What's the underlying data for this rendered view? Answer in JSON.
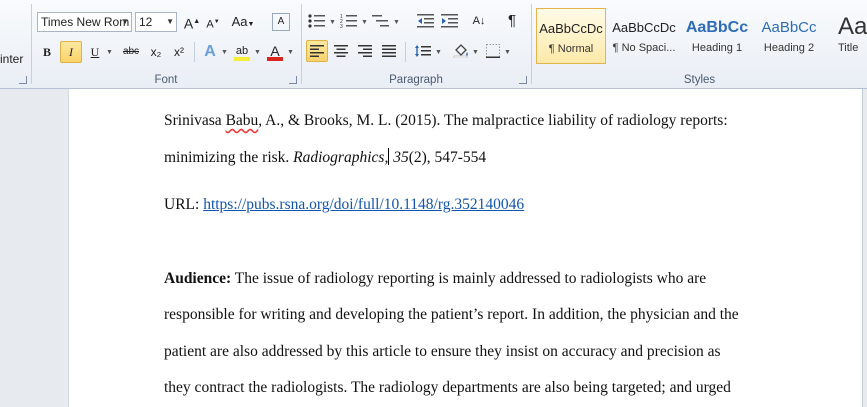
{
  "ribbon": {
    "clipboard": {
      "label": "inter"
    },
    "font": {
      "label": "Font",
      "font_name": "Times New Rom",
      "font_size": "12",
      "grow_glyph": "A",
      "shrink_glyph": "A",
      "change_case_glyph": "Aa",
      "clear_glyph": "A",
      "bold_glyph": "B",
      "italic_glyph": "I",
      "underline_glyph": "U",
      "strike_glyph": "abc",
      "subscript_glyph": "x₂",
      "superscript_glyph": "x²",
      "effects_glyph": "A",
      "highlight_glyph": "ab",
      "color_glyph": "A",
      "highlight_color": "#f6ee3a",
      "font_color": "#d7261e"
    },
    "paragraph": {
      "label": "Paragraph",
      "pilcrow_glyph": "¶",
      "sort_glyph": "A↓"
    },
    "styles": {
      "label": "Styles",
      "items": [
        {
          "preview": "AaBbCcDc",
          "name": "¶ Normal"
        },
        {
          "preview": "AaBbCcDc",
          "name": "¶ No Spaci..."
        },
        {
          "preview": "AaBbCc",
          "name": "Heading 1"
        },
        {
          "preview": "AaBbCc",
          "name": "Heading 2"
        },
        {
          "preview": "Aa",
          "name": "Title"
        }
      ],
      "heading_color": "#2e6db5"
    }
  },
  "document": {
    "ref_line1_pre": "Srinivasa ",
    "ref_line1_name": "Babu",
    "ref_line1_post": ", A., & Brooks, M. L. (2015). The malpractice liability of radiology reports:",
    "ref_line2_pre": "minimizing the risk. ",
    "ref_line2_journal": "Radiographics",
    "ref_line2_comma": ",",
    "ref_line2_volume": " 35",
    "ref_line2_post": "(2), 547-554",
    "url_label": "URL: ",
    "url": "https://pubs.rsna.org/doi/full/10.1148/rg.352140046",
    "audience_heading": "Audience:",
    "audience_line1": " The issue of radiology reporting is mainly addressed to radiologists who are",
    "audience_line2": "responsible for writing and developing the patient’s report. In addition, the physician and the",
    "audience_line3": "patient are also addressed by this article to ensure they insist on accuracy and precision as",
    "audience_line4": "they contract the radiologists. The radiology departments are also being targeted; and urged"
  }
}
